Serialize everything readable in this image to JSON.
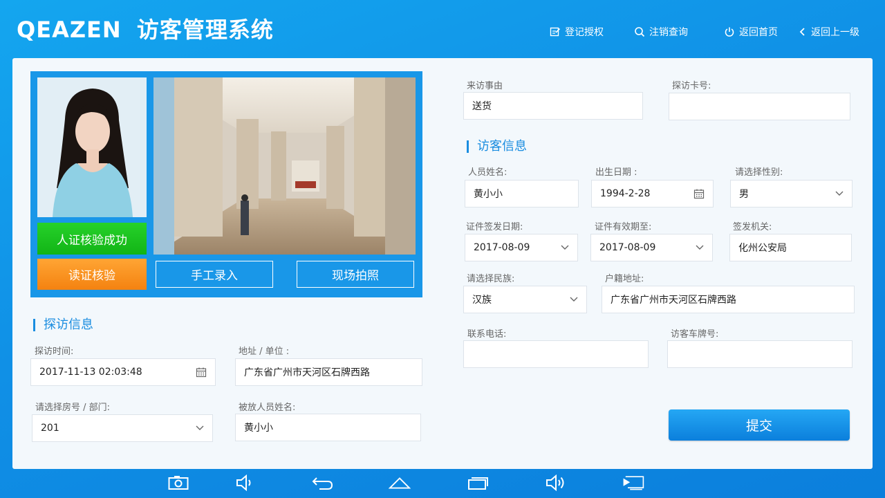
{
  "header": {
    "brand": "QEAZEN",
    "title": "访客管理系统",
    "nav": {
      "register_auth": "登记授权",
      "cancel_query": "注销查询",
      "home": "返回首页",
      "back": "返回上一级"
    }
  },
  "photo_panel": {
    "verify_success": "人证核验成功",
    "read_id": "读证核验",
    "manual_entry": "手工录入",
    "live_photo": "现场拍照"
  },
  "visit_info": {
    "section_title": "探访信息",
    "visit_time_label": "探访时间:",
    "visit_time_value": "2017-11-13 02:03:48",
    "address_label": "地址 / 单位 :",
    "address_value": "广东省广州市天河区石牌西路",
    "room_label": "请选择房号 / 部门:",
    "room_value": "201",
    "visitee_label": "被放人员姓名:",
    "visitee_value": "黄小小"
  },
  "reason": {
    "reason_label": "来访事由",
    "reason_value": "送货",
    "card_label": "探访卡号:",
    "card_value": ""
  },
  "visitor_info": {
    "section_title": "访客信息",
    "name_label": "人员姓名:",
    "name_value": "黄小小",
    "birth_label": "出生日期 :",
    "birth_value": "1994-2-28",
    "gender_label": "请选择性别:",
    "gender_value": "男",
    "issue_date_label": "证件签发日期:",
    "issue_date_value": "2017-08-09",
    "valid_until_label": "证件有效期至:",
    "valid_until_value": "2017-08-09",
    "authority_label": "签发机关:",
    "authority_value": "化州公安局",
    "ethnicity_label": "请选择民族:",
    "ethnicity_value": "汉族",
    "domicile_label": "户籍地址:",
    "domicile_value": "广东省广州市天河区石牌西路",
    "phone_label": "联系电话:",
    "phone_value": "",
    "plate_label": "访客车牌号:",
    "plate_value": ""
  },
  "submit_label": "提交",
  "system_bar": {
    "icons": [
      "screenshot-icon",
      "volume-down-icon",
      "back-icon",
      "home-icon",
      "recent-apps-icon",
      "volume-up-icon",
      "screen-cast-icon"
    ]
  },
  "colors": {
    "primary": "#1a8de0",
    "success": "#18c01c",
    "warning": "#f68c1e"
  }
}
